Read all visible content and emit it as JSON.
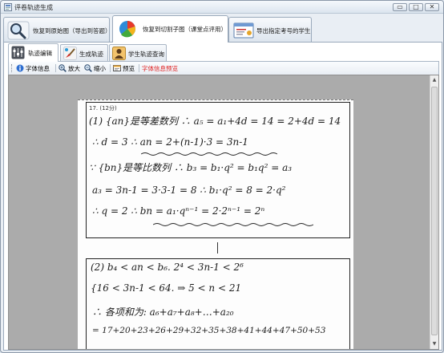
{
  "window": {
    "title": "评卷轨迹生成",
    "controls": {
      "minimize": "▭",
      "maximize": "□",
      "close": "✕"
    }
  },
  "main_tabs": [
    {
      "label": "恢复到原始图（导出到答题）",
      "icon": "magnifier-icon",
      "active": false
    },
    {
      "label": "恢复到切割子图（课堂点评用）",
      "icon": "pie-chart-icon",
      "active": true
    },
    {
      "label": "导出指定考号的学生",
      "icon": "certificate-icon",
      "active": false
    }
  ],
  "sub_tabs": [
    {
      "label": "轨迹编辑",
      "icon": "sliders-icon",
      "active": true
    },
    {
      "label": "生成轨迹",
      "icon": "brush-icon",
      "active": false
    },
    {
      "label": "学生轨迹查询",
      "icon": "student-icon",
      "active": false
    }
  ],
  "toolbar": {
    "font_info": "字体信息",
    "zoom_in": "放大",
    "zoom_out": "缩小",
    "preview": "预览",
    "font_preview": "字体信息预览"
  },
  "document": {
    "q_number": "17. (12分)",
    "lines1": [
      "(1) {an}是等差数列 ∴ a₅ = a₁+4d = 14 = 2+4d = 14",
      "∴ d = 3    ∴ an = 2+(n-1)·3 = 3n-1",
      "∵ {bn}是等比数列  ∴ b₃ = b₁·q² = b₁q² = a₃",
      "a₃ = 3n-1 = 3·3-1 = 8   ∴ b₁·q² = 8 = 2·q²",
      "∴ q = 2    ∴ bn = a₁·qⁿ⁻¹ = 2·2ⁿ⁻¹ = 2ⁿ"
    ],
    "lines2": [
      "(2)  b₄ < an < b₆.    2⁴ < 3n-1 < 2⁶",
      "{16 < 3n-1 < 64. ⇒  5 < n < 21",
      "∴ 各项和为: a₆+a₇+a₈+…+a₂₀",
      "= 17+20+23+26+29+32+35+38+41+44+47+50+53"
    ]
  },
  "colors": {
    "accent_red": "#e02020",
    "tab_border": "#9aa9bb",
    "viewer_bg": "#ababab"
  }
}
